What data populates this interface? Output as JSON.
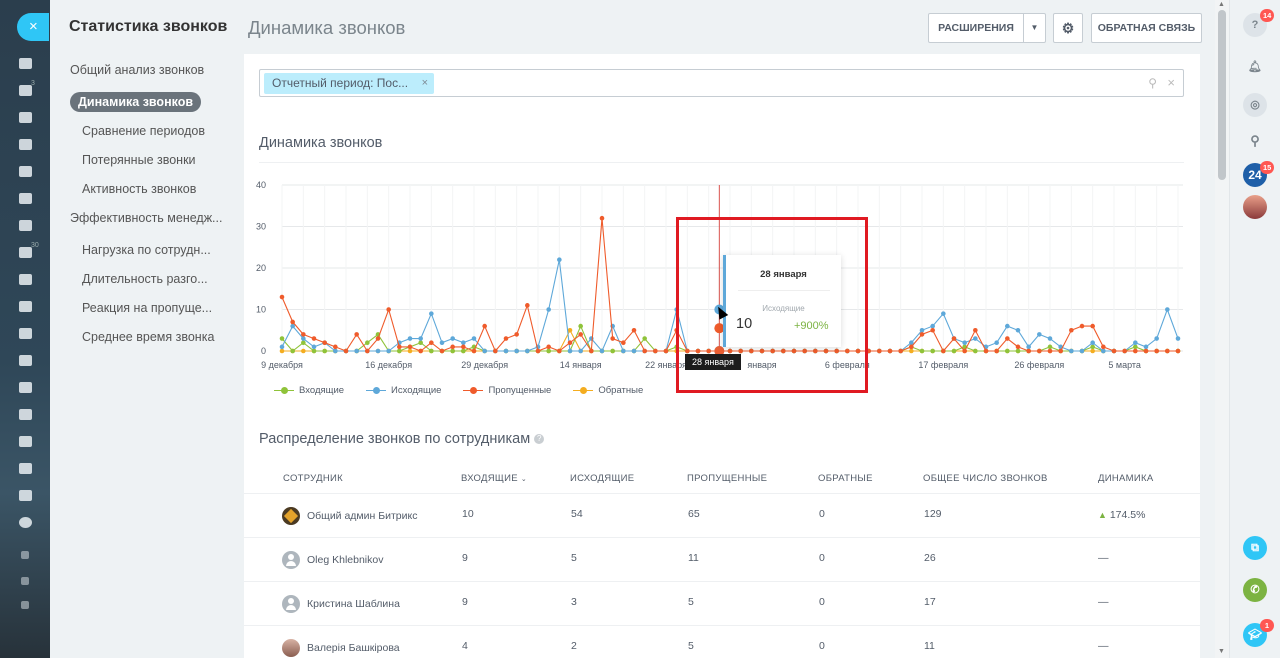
{
  "sidebar_left": {
    "close_icon": "×",
    "badges": [
      "3",
      "30"
    ]
  },
  "menu": {
    "title": "Статистика звонков",
    "items": [
      {
        "label": "Общий анализ звонков",
        "level": 0
      },
      {
        "label": "Динамика звонков",
        "level": 1,
        "active": true
      },
      {
        "label": "Сравнение периодов",
        "level": 1
      },
      {
        "label": "Потерянные звонки",
        "level": 1
      },
      {
        "label": "Активность звонков",
        "level": 1
      },
      {
        "label": "Эффективность менедж...",
        "level": 0
      },
      {
        "label": "Нагрузка по сотрудн...",
        "level": 1
      },
      {
        "label": "Длительность разго...",
        "level": 1
      },
      {
        "label": "Реакция на пропуще...",
        "level": 1
      },
      {
        "label": "Среднее время звонка",
        "level": 1
      }
    ]
  },
  "header": {
    "title": "Динамика звонков",
    "extensions_button": "РАСШИРЕНИЯ",
    "feedback_button": "ОБРАТНАЯ СВЯЗЬ"
  },
  "filter": {
    "chip": "Отчетный период: Пос...",
    "chip_remove": "×",
    "clear": "×"
  },
  "chart_title": "Динамика звонков",
  "chart_data": {
    "type": "line",
    "ylim": [
      0,
      40
    ],
    "yticks": [
      0,
      10,
      20,
      30,
      40
    ],
    "x_count": 85,
    "x_tick_labels": [
      {
        "index": 0,
        "label": "9 декабря"
      },
      {
        "index": 10,
        "label": "16 декабря"
      },
      {
        "index": 19,
        "label": "29 декабря"
      },
      {
        "index": 28,
        "label": "14 января"
      },
      {
        "index": 36,
        "label": "22 января"
      },
      {
        "index": 45,
        "label": "января"
      },
      {
        "index": 53,
        "label": "6 февраля"
      },
      {
        "index": 62,
        "label": "17 февраля"
      },
      {
        "index": 71,
        "label": "26 февраля"
      },
      {
        "index": 79,
        "label": "5 марта"
      }
    ],
    "cursor_index": 41,
    "series": [
      {
        "name": "Входящие",
        "color": "#8fc33a",
        "values": [
          3,
          0,
          2,
          0,
          0,
          0,
          0,
          0,
          2,
          4,
          0,
          0,
          1,
          2,
          0,
          0,
          0,
          0,
          1,
          0,
          0,
          0,
          0,
          0,
          0,
          0,
          0,
          0,
          6,
          0,
          0,
          0,
          0,
          0,
          3,
          0,
          0,
          1,
          0,
          0,
          0,
          0,
          0,
          0,
          0,
          0,
          0,
          0,
          0,
          0,
          0,
          0,
          0,
          0,
          0,
          0,
          0,
          0,
          0,
          1,
          0,
          0,
          0,
          0,
          1,
          0,
          0,
          0,
          0,
          0,
          0,
          0,
          1,
          0,
          0,
          0,
          1,
          0,
          0,
          0,
          1,
          0,
          0,
          0,
          0
        ]
      },
      {
        "name": "Исходящие",
        "color": "#5ea8d9",
        "values": [
          1,
          6,
          3,
          1,
          2,
          0,
          0,
          0,
          0,
          0,
          0,
          2,
          3,
          3,
          9,
          2,
          3,
          2,
          3,
          0,
          0,
          0,
          0,
          0,
          1,
          10,
          22,
          0,
          0,
          3,
          0,
          6,
          0,
          0,
          0,
          0,
          0,
          10,
          0,
          0,
          0,
          0,
          0,
          0,
          0,
          0,
          0,
          0,
          0,
          0,
          0,
          0,
          0,
          0,
          0,
          0,
          0,
          0,
          0,
          2,
          5,
          6,
          9,
          3,
          2,
          3,
          1,
          2,
          6,
          5,
          1,
          4,
          3,
          1,
          0,
          0,
          2,
          0,
          0,
          0,
          2,
          1,
          3,
          10,
          3
        ]
      },
      {
        "name": "Пропущенные",
        "color": "#ef5b2b",
        "values": [
          13,
          7,
          4,
          3,
          2,
          1,
          0,
          4,
          0,
          3,
          10,
          1,
          1,
          0,
          2,
          0,
          1,
          1,
          0,
          6,
          0,
          3,
          4,
          11,
          0,
          1,
          0,
          2,
          4,
          0,
          32,
          3,
          2,
          5,
          0,
          0,
          0,
          5,
          0,
          0,
          0,
          0,
          0,
          0,
          0,
          0,
          0,
          0,
          0,
          0,
          0,
          0,
          0,
          0,
          0,
          0,
          0,
          0,
          0,
          1,
          4,
          5,
          0,
          3,
          0,
          5,
          0,
          0,
          3,
          1,
          0,
          0,
          0,
          0,
          5,
          6,
          6,
          1,
          0,
          0,
          0,
          0,
          0,
          0,
          0
        ]
      },
      {
        "name": "Обратные",
        "color": "#f4ad20",
        "values": [
          0,
          0,
          0,
          0,
          0,
          0,
          0,
          0,
          0,
          0,
          0,
          0,
          0,
          0,
          0,
          0,
          0,
          0,
          0,
          0,
          0,
          0,
          0,
          0,
          0,
          0,
          0,
          5,
          0,
          0,
          0,
          0,
          0,
          0,
          0,
          0,
          0,
          0,
          0,
          0,
          0,
          0,
          0,
          0,
          0,
          0,
          0,
          0,
          0,
          0,
          0,
          0,
          0,
          0,
          0,
          0,
          0,
          0,
          0,
          0,
          0,
          0,
          0,
          0,
          0,
          0,
          0,
          0,
          0,
          0,
          0,
          0,
          0,
          0,
          0,
          0,
          0,
          0,
          0,
          0,
          0,
          0,
          0,
          0,
          0
        ]
      }
    ],
    "legend": "bottom-left",
    "grid": true
  },
  "tooltip": {
    "date": "28 января",
    "series": "Исходящие",
    "value": "10",
    "change": "+900%",
    "x_flag": "28 января"
  },
  "table": {
    "title": "Распределение звонков по сотрудникам",
    "help_icon": "?",
    "headers": {
      "employee": "Сотрудник",
      "incoming": "Входящие",
      "outgoing": "Исходящие",
      "missed": "Пропущенные",
      "callback": "Обратные",
      "total": "Общее число звонков",
      "dynamics": "Динамика"
    },
    "rows": [
      {
        "name": "Общий админ Битрикс",
        "incoming": "10",
        "outgoing": "54",
        "missed": "65",
        "callback": "0",
        "total": "129",
        "dynamics": "174.5%"
      },
      {
        "name": "Oleg Khlebnikov",
        "incoming": "9",
        "outgoing": "5",
        "missed": "11",
        "callback": "0",
        "total": "26",
        "dynamics": "—"
      },
      {
        "name": "Кристина Шаблина",
        "incoming": "9",
        "outgoing": "3",
        "missed": "5",
        "callback": "0",
        "total": "17",
        "dynamics": "—"
      },
      {
        "name": "Валерія Башкірова",
        "incoming": "4",
        "outgoing": "2",
        "missed": "5",
        "callback": "0",
        "total": "11",
        "dynamics": "—"
      }
    ]
  },
  "rightbar": {
    "help_badge": "14",
    "b24_label": "24",
    "b24_badge": "15",
    "learn_badge": "1"
  }
}
